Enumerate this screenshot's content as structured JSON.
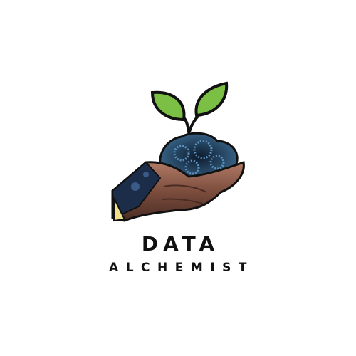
{
  "logo": {
    "title": "DATA",
    "subtitle": "ALCHEMIST",
    "colors": {
      "leaf": "#7cbf45",
      "outline": "#111111",
      "data_blob": "#2a4a6a",
      "hand": "#8a5a48",
      "cuff": "#f2e08a"
    }
  }
}
